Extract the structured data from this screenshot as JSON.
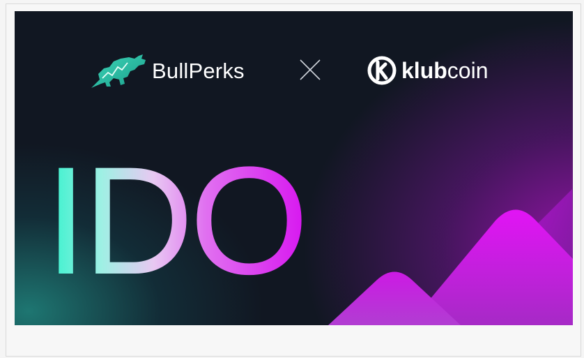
{
  "banner": {
    "partner_left": "BullPerks",
    "separator": "×",
    "partner_right_bold": "klub",
    "partner_right_light": "coin",
    "headline": "IDO",
    "icons": {
      "left_logo": "bull-icon",
      "separator": "close-icon",
      "right_logo": "klubcoin-k-icon"
    },
    "colors": {
      "background": "#111722",
      "teal_accent": "#2cd3b4",
      "magenta_accent": "#e010f0",
      "text": "#ffffff"
    }
  }
}
